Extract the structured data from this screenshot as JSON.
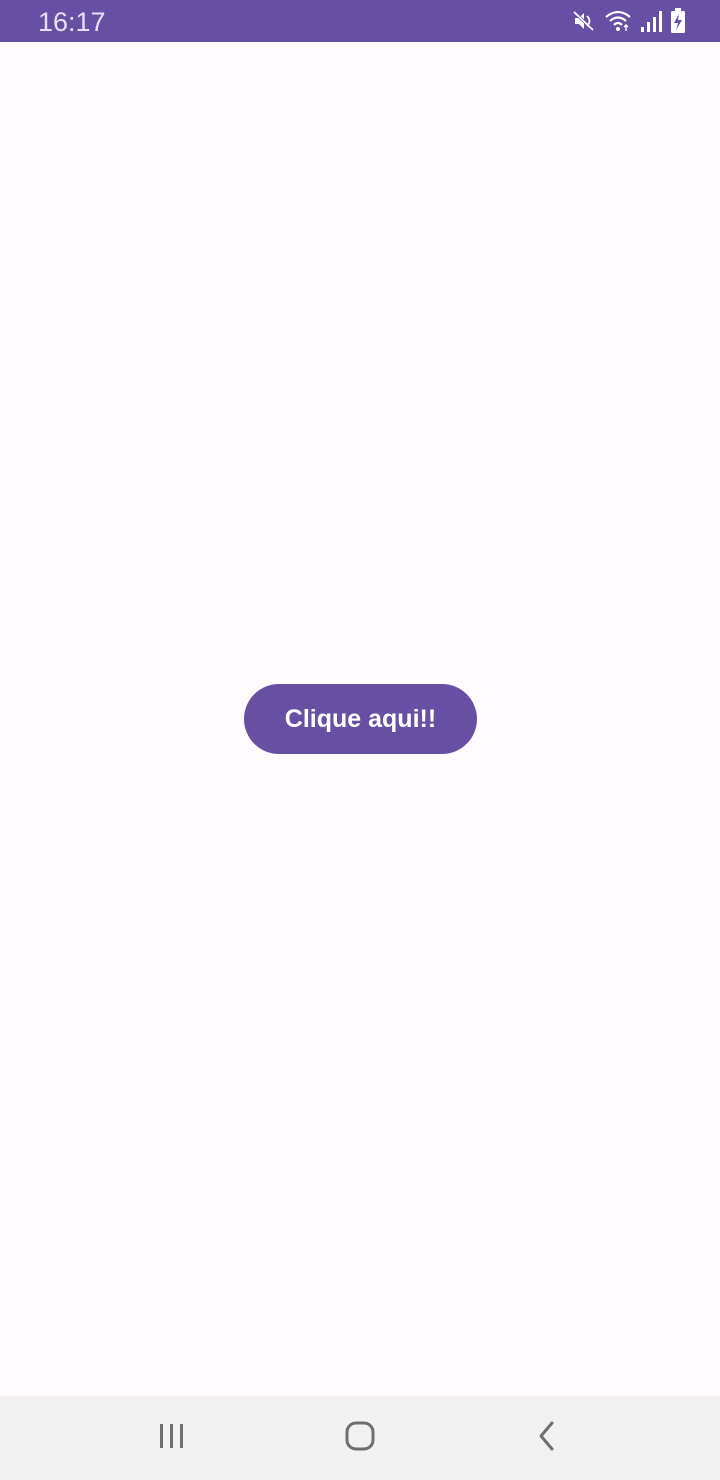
{
  "status_bar": {
    "time": "16:17",
    "background": "#6750a4",
    "icons": [
      "mute-icon",
      "wifi-icon",
      "signal-icon",
      "battery-charging-icon"
    ]
  },
  "main": {
    "button_label": "Clique aqui!!",
    "button_color": "#6750a4",
    "background": "#fffbfe"
  },
  "nav_bar": {
    "items": [
      "recent-apps-icon",
      "home-icon",
      "back-icon"
    ]
  }
}
